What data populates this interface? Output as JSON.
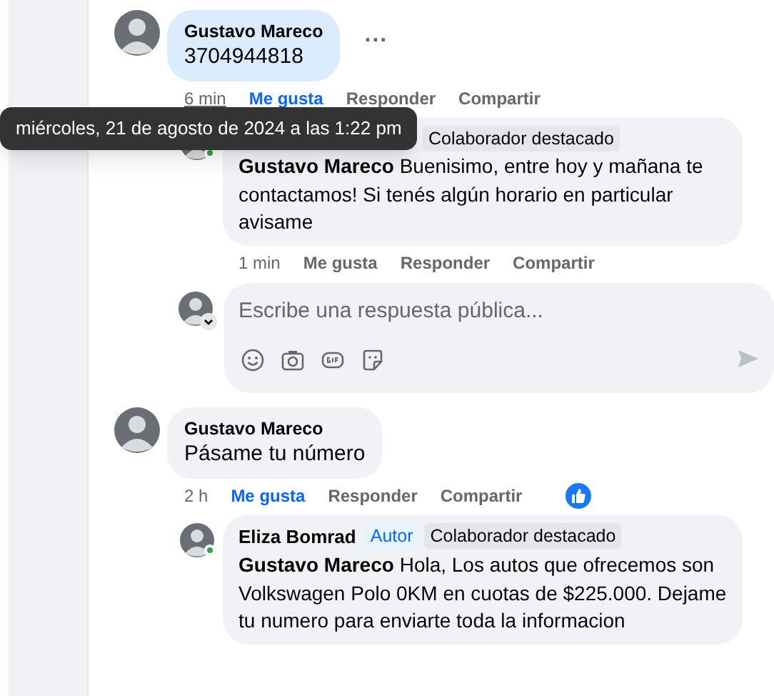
{
  "comments": [
    {
      "author": "Gustavo Mareco",
      "text": "3704944818",
      "highlighted": true,
      "more": "...",
      "time": "6 min",
      "time_hovered": true,
      "like": "Me gusta",
      "liked": true,
      "reply": "Responder",
      "share": "Compartir",
      "reaction": false,
      "replies": [
        {
          "badges": [
            {
              "text": "Colaborador destacado",
              "kind": "plain"
            }
          ],
          "online": true,
          "text": "**Gustavo Mareco** Buenisimo, entre hoy y mañana te contactamos! Si tenés algún horario en particular avisame",
          "time": "1 min",
          "like": "Me gusta",
          "liked": false,
          "reply": "Responder",
          "share": "Compartir"
        }
      ],
      "composer": {
        "placeholder": "Escribe una respuesta pública..."
      }
    },
    {
      "author": "Gustavo Mareco",
      "text": "Pásame tu número",
      "highlighted": false,
      "time": "2 h",
      "time_hovered": false,
      "like": "Me gusta",
      "liked": true,
      "reply": "Responder",
      "share": "Compartir",
      "reaction": true,
      "replies": [
        {
          "author": "Eliza Bomrad",
          "badges": [
            {
              "text": "Autor",
              "kind": "author"
            },
            {
              "text": "Colaborador destacado",
              "kind": "plain"
            }
          ],
          "online": true,
          "text": "**Gustavo Mareco** Hola, Los autos que ofrecemos son Volkswagen Polo 0KM en cuotas de $225.000. Dejame tu numero para enviarte toda la informacion"
        }
      ]
    }
  ],
  "tooltip": "miércoles, 21 de agosto de 2024 a las 1:22 pm"
}
